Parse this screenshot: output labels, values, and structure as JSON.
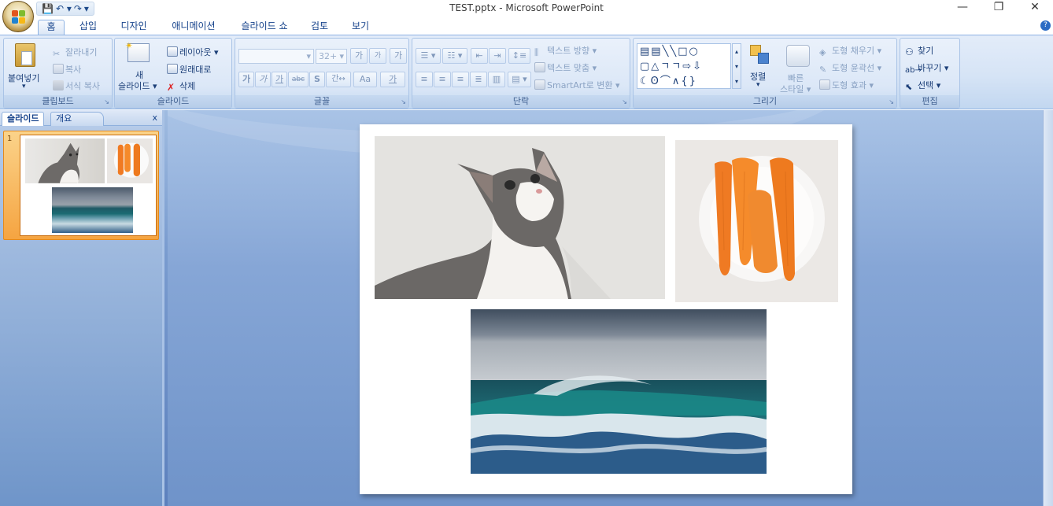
{
  "window": {
    "title": "TEST.pptx - Microsoft PowerPoint",
    "minimize": "—",
    "restore": "❐",
    "close": "✕"
  },
  "qat": {
    "save": "💾",
    "undo": "↶ ▾",
    "redo": "↷",
    "customize": "▾"
  },
  "tabs": [
    {
      "label": "홈",
      "active": true
    },
    {
      "label": "삽입"
    },
    {
      "label": "디자인"
    },
    {
      "label": "애니메이션"
    },
    {
      "label": "슬라이드 쇼"
    },
    {
      "label": "검토"
    },
    {
      "label": "보기"
    }
  ],
  "help": "?",
  "clipboard": {
    "label": "클립보드",
    "paste": "붙여넣기",
    "cut": "잘라내기",
    "copy": "복사",
    "format_painter": "서식 복사"
  },
  "slides_group": {
    "label": "슬라이드",
    "new_slide_line1": "새",
    "new_slide_line2": "슬라이드 ▾",
    "layout": "레이아웃 ▾",
    "reset": "원래대로",
    "delete": "삭제"
  },
  "font": {
    "label": "글꼴",
    "font_name": "",
    "font_size": "32+",
    "grow": "가",
    "shrink": "가",
    "clear": "가",
    "bold": "가",
    "italic": "가",
    "underline": "가",
    "strike": "abc",
    "shadow": "S",
    "spacing": "간↔",
    "case": "Aa",
    "color": "가"
  },
  "paragraph": {
    "label": "단락",
    "text_direction": "텍스트 방향 ▾",
    "align_text": "텍스트 맞춤 ▾",
    "smartart": "SmartArt로 변환 ▾"
  },
  "drawing": {
    "label": "그리기",
    "arrange": "정렬",
    "quick_styles_line1": "빠른",
    "quick_styles_line2": "스타일 ▾",
    "fill": "도형 채우기 ▾",
    "outline": "도형 윤곽선 ▾",
    "effects": "도형 효과 ▾"
  },
  "editing": {
    "label": "편집",
    "find": "찾기",
    "replace": "바꾸기 ▾",
    "select": "선택 ▾"
  },
  "slide_pane": {
    "tab_slides": "슬라이드",
    "tab_outline": "개요",
    "close": "x",
    "slide_number": "1"
  },
  "colors": {
    "ribbon_text": "#15428b",
    "selection": "#f5a441",
    "workspace": "#6f93c9"
  }
}
